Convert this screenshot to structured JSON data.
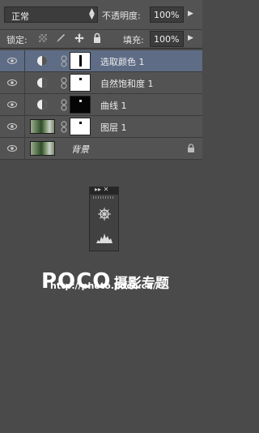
{
  "toolbar": {
    "blend_mode": "正常",
    "opacity_label": "不透明度:",
    "opacity_value": "100%",
    "lock_label": "锁定:",
    "fill_label": "填充:",
    "fill_value": "100%"
  },
  "layers": [
    {
      "name": "选取颜色 1",
      "selected": true
    },
    {
      "name": "自然饱和度 1",
      "selected": false
    },
    {
      "name": "曲线 1",
      "selected": false
    },
    {
      "name": "图层 1",
      "selected": false
    },
    {
      "name": "背景",
      "selected": false
    }
  ],
  "floating_panel": {
    "header_icons": "▸▸ ✕"
  },
  "watermark": {
    "logo": "POCO",
    "tagline": "摄影专题",
    "url": "http://photo.poco.cn/"
  }
}
